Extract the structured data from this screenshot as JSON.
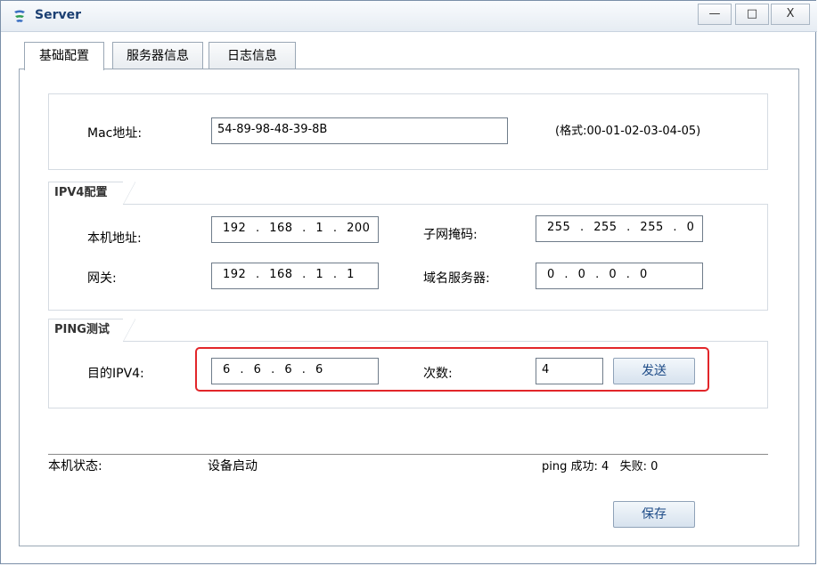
{
  "window": {
    "title": "Server",
    "minimize": "—",
    "maximize": "□",
    "close": "X"
  },
  "tabs": [
    {
      "label": "基础配置"
    },
    {
      "label": "服务器信息"
    },
    {
      "label": "日志信息"
    }
  ],
  "mac": {
    "label": "Mac地址:",
    "value": "54-89-98-48-39-8B",
    "hint": "(格式:00-01-02-03-04-05)"
  },
  "ipv4": {
    "group_title": "IPV4配置",
    "local_label": "本机地址:",
    "local_value": "192 . 168 . 1 . 200",
    "mask_label": "子网掩码:",
    "mask_value": "255 . 255 . 255 . 0",
    "gateway_label": "网关:",
    "gateway_value": "192 . 168 . 1 . 1",
    "dns_label": "域名服务器:",
    "dns_value": "0 . 0 . 0 . 0"
  },
  "ping": {
    "group_title": "PING测试",
    "target_label": "目的IPV4:",
    "target_value": "6 . 6 . 6 . 6",
    "count_label": "次数:",
    "count_value": "4",
    "send_label": "发送"
  },
  "status": {
    "label": "本机状态:",
    "value": "设备启动",
    "ping_result": "ping 成功: 4   失败: 0"
  },
  "save_label": "保存"
}
